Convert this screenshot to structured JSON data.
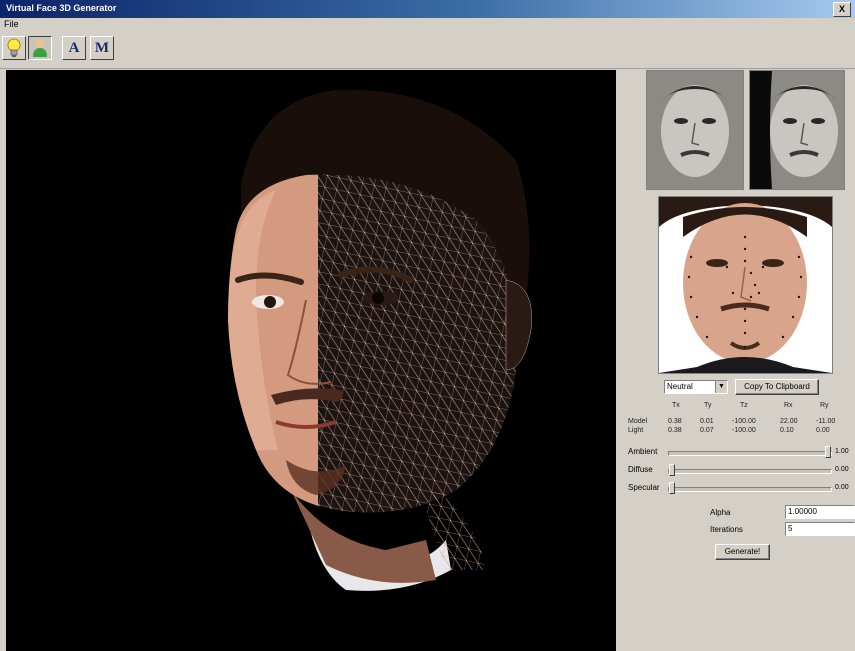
{
  "window": {
    "title": "Virtual Face 3D Generator",
    "close_label": "X"
  },
  "menu": {
    "file_label": "File"
  },
  "toolbar": {
    "buttons": [
      {
        "name": "light-button",
        "icon": "lightbulb-icon"
      },
      {
        "name": "person-button",
        "icon": "person-icon"
      },
      {
        "name": "a-button",
        "label": "A"
      },
      {
        "name": "m-button",
        "label": "M"
      }
    ]
  },
  "controls": {
    "view_select": "Neutral",
    "copy_button": "Copy To Clipboard",
    "generate_button": "Generate!"
  },
  "coords": {
    "headers": [
      "Tx",
      "Ty",
      "Tz",
      "Rx",
      "Ry"
    ],
    "rows": [
      {
        "label": "Model",
        "values": [
          "0.38",
          "0.01",
          "-100.00",
          "22.00",
          "-11.00"
        ]
      },
      {
        "label": "Light",
        "values": [
          "0.38",
          "0.07",
          "-100.00",
          "0.10",
          "0.00"
        ]
      }
    ]
  },
  "sliders": [
    {
      "label": "Ambient",
      "value": "1.00",
      "level": 1.0
    },
    {
      "label": "Diffuse",
      "value": "0.00",
      "level": 0.0
    },
    {
      "label": "Specular",
      "value": "0.00",
      "level": 0.0
    }
  ],
  "fields": [
    {
      "label": "Alpha",
      "value": "1.00000"
    },
    {
      "label": "Iterations",
      "value": "5"
    }
  ],
  "colors": {
    "titlebar_start": "#0a246a",
    "titlebar_end": "#a6caf0",
    "panel": "#d4d0c8",
    "viewport": "#000000",
    "mesh": "#c9a08c"
  }
}
